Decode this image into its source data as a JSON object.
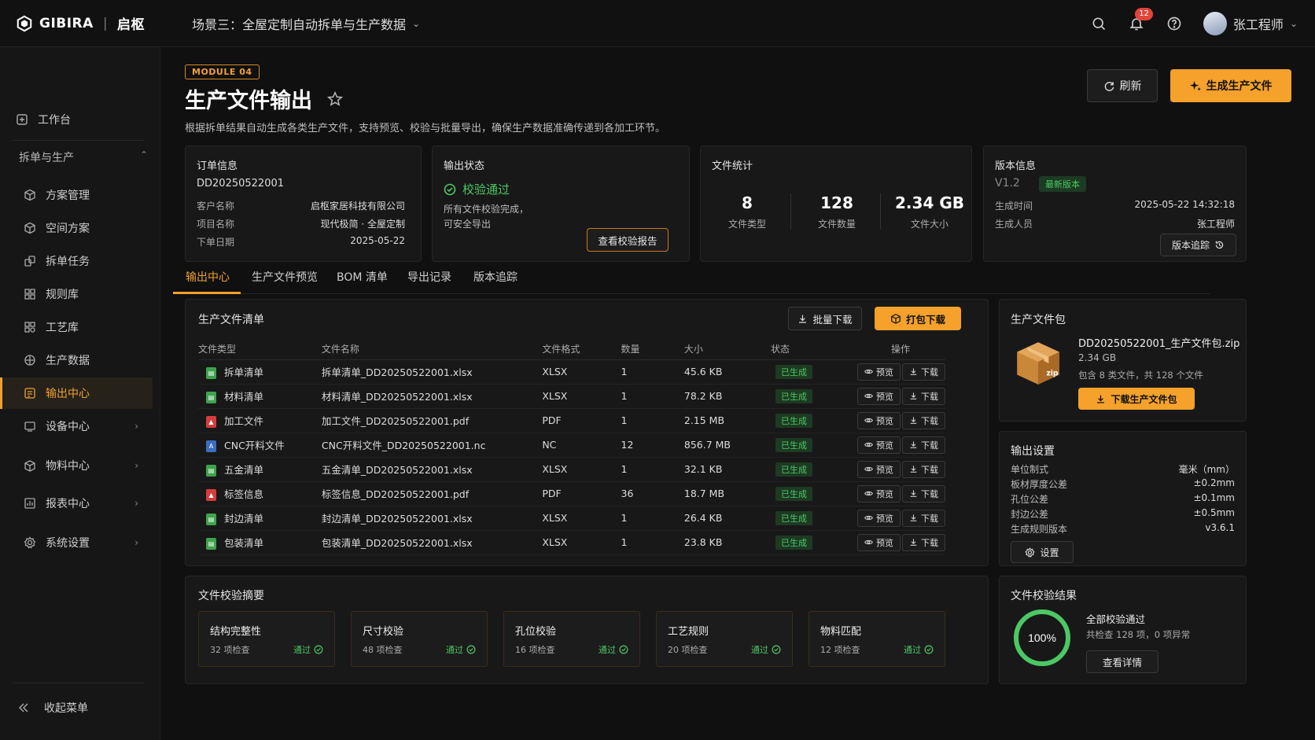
{
  "header": {
    "brand": "GIBIRA",
    "brand_cn": "启枢",
    "scene": "场景三：全屋定制自动拆单与生产数据",
    "notification_count": "12",
    "user_name": "张工程师"
  },
  "sidebar": {
    "workbench": "工作台",
    "group_label": "拆单与生产",
    "items": [
      {
        "label": "方案管理",
        "icon": "cube-icon"
      },
      {
        "label": "空间方案",
        "icon": "cube-icon"
      },
      {
        "label": "拆单任务",
        "icon": "split-icon"
      },
      {
        "label": "规则库",
        "icon": "grid-icon"
      },
      {
        "label": "工艺库",
        "icon": "grid-icon"
      },
      {
        "label": "生产数据",
        "icon": "database-icon"
      },
      {
        "label": "输出中心",
        "icon": "output-icon"
      },
      {
        "label": "设备中心",
        "icon": "device-icon"
      },
      {
        "label": "物料中心",
        "icon": "box-icon"
      },
      {
        "label": "报表中心",
        "icon": "report-icon"
      },
      {
        "label": "系统设置",
        "icon": "gear-icon"
      }
    ],
    "collapse": "收起菜单"
  },
  "page": {
    "module_tag": "MODULE 04",
    "title": "生产文件输出",
    "description": "根据拆单结果自动生成各类生产文件，支持预览、校验与批量导出，确保生产数据准确传递到各加工环节。",
    "refresh_label": "刷新",
    "generate_label": "生成生产文件"
  },
  "order": {
    "title": "订单信息",
    "order_no": "DD20250522001",
    "rows": [
      {
        "k": "客户名称",
        "v": "启枢家居科技有限公司"
      },
      {
        "k": "项目名称",
        "v": "现代极简 · 全屋定制"
      },
      {
        "k": "下单日期",
        "v": "2025-05-22"
      }
    ]
  },
  "output_status": {
    "title": "输出状态",
    "status": "校验通过",
    "line1": "所有文件校验完成，",
    "line2": "可安全导出",
    "report_btn": "查看校验报告",
    "status_color": "#4cc765"
  },
  "file_stats": {
    "title": "文件统计",
    "types": "8",
    "types_label": "文件类型",
    "count": "128",
    "count_label": "文件数量",
    "size": "2.34 GB",
    "size_label": "文件大小"
  },
  "version": {
    "title": "版本信息",
    "version": "V1.2",
    "latest": "最新版本",
    "rows": [
      {
        "k": "生成时间",
        "v": "2025-05-22 14:32:18"
      },
      {
        "k": "生成人员",
        "v": "张工程师"
      }
    ],
    "trace_btn": "版本追踪"
  },
  "tabs": [
    "输出中心",
    "生产文件预览",
    "BOM 清单",
    "导出记录",
    "版本追踪"
  ],
  "file_list": {
    "title": "生产文件清单",
    "batch_download": "批量下载",
    "pack_download": "打包下载",
    "columns": [
      "文件类型",
      "文件名称",
      "文件格式",
      "数量",
      "大小",
      "状态",
      "操作"
    ],
    "preview": "预览",
    "download": "下载",
    "rows": [
      {
        "type": "拆单清单",
        "kind": "x",
        "name": "拆单清单_DD20250522001.xlsx",
        "fmt": "XLSX",
        "qty": "1",
        "size": "45.6 KB",
        "status": "已生成"
      },
      {
        "type": "材料清单",
        "kind": "x",
        "name": "材料清单_DD20250522001.xlsx",
        "fmt": "XLSX",
        "qty": "1",
        "size": "78.2 KB",
        "status": "已生成"
      },
      {
        "type": "加工文件",
        "kind": "p",
        "name": "加工文件_DD20250522001.pdf",
        "fmt": "PDF",
        "qty": "1",
        "size": "2.15 MB",
        "status": "已生成"
      },
      {
        "type": "CNC开料文件",
        "kind": "n",
        "name": "CNC开料文件_DD20250522001.nc",
        "fmt": "NC",
        "qty": "12",
        "size": "856.7 MB",
        "status": "已生成"
      },
      {
        "type": "五金清单",
        "kind": "x",
        "name": "五金清单_DD20250522001.xlsx",
        "fmt": "XLSX",
        "qty": "1",
        "size": "32.1 KB",
        "status": "已生成"
      },
      {
        "type": "标签信息",
        "kind": "p",
        "name": "标签信息_DD20250522001.pdf",
        "fmt": "PDF",
        "qty": "36",
        "size": "18.7 MB",
        "status": "已生成"
      },
      {
        "type": "封边清单",
        "kind": "x",
        "name": "封边清单_DD20250522001.xlsx",
        "fmt": "XLSX",
        "qty": "1",
        "size": "26.4 KB",
        "status": "已生成"
      },
      {
        "type": "包装清单",
        "kind": "x",
        "name": "包装清单_DD20250522001.xlsx",
        "fmt": "XLSX",
        "qty": "1",
        "size": "23.8 KB",
        "status": "已生成"
      }
    ]
  },
  "package": {
    "title": "生产文件包",
    "name": "DD20250522001_生产文件包.zip",
    "size": "2.34 GB",
    "desc": "包含 8 类文件，共 128 个文件",
    "download_btn": "下载生产文件包"
  },
  "output_settings": {
    "title": "输出设置",
    "rows": [
      {
        "k": "单位制式",
        "v": "毫米（mm）"
      },
      {
        "k": "板材厚度公差",
        "v": "±0.2mm"
      },
      {
        "k": "孔位公差",
        "v": "±0.1mm"
      },
      {
        "k": "封边公差",
        "v": "±0.5mm"
      },
      {
        "k": "生成规则版本",
        "v": "v3.6.1"
      }
    ],
    "settings_btn": "设置"
  },
  "validation_summary": {
    "title": "文件校验摘要",
    "pass_label": "通过",
    "items": [
      {
        "t": "结构完整性",
        "c": "32 项检查"
      },
      {
        "t": "尺寸校验",
        "c": "48 项检查"
      },
      {
        "t": "孔位校验",
        "c": "16 项检查"
      },
      {
        "t": "工艺规则",
        "c": "20 项检查"
      },
      {
        "t": "物料匹配",
        "c": "12 项检查"
      }
    ]
  },
  "validation_result": {
    "title": "文件校验结果",
    "percent": "100%",
    "percent_value": 1.0,
    "headline": "全部校验通过",
    "detail": "共检查 128 项，0 项异常",
    "detail_btn": "查看详情"
  },
  "colors": {
    "accent": "#f5a12b",
    "success": "#4cc765",
    "bg": "#101010"
  }
}
